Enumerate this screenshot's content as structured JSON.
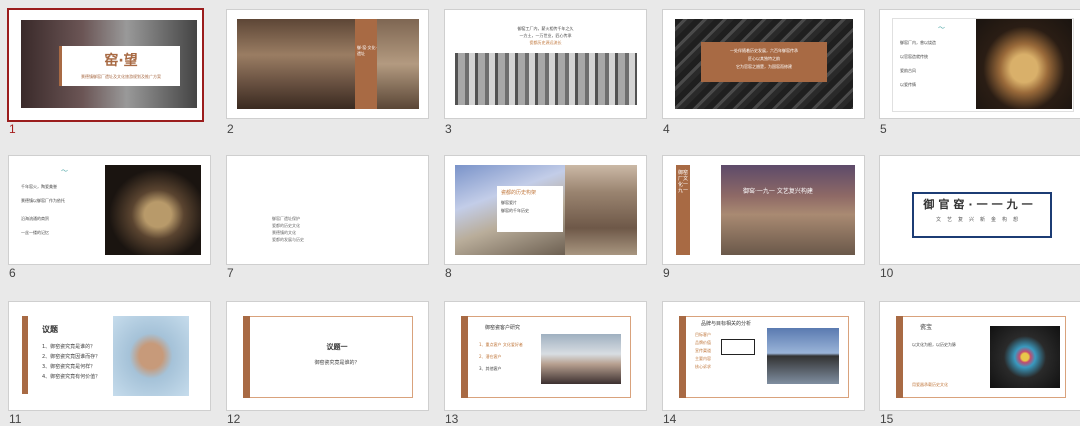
{
  "slides": [
    {
      "n": "1",
      "title": "窑·望",
      "subtitle": "景德镇御窑厂遗址及文化旅游规划及推广方案"
    },
    {
      "n": "2",
      "caption": "御·窑·文化·遗址",
      "sub": "景德镇"
    },
    {
      "n": "3",
      "lines": [
        "御窑工厂内，薪火相传千年之久",
        "一方土，一万世业，匠心传承",
        "瓷都历史源远流长"
      ]
    },
    {
      "n": "4",
      "lines": [
        "一处伴随着历史发展，六百年御窑传承",
        "匠心以其独特之韵",
        "它为官窑之翘楚，为国窑而修建"
      ]
    },
    {
      "n": "5",
      "lines": [
        "御窑厂内，曾以烧造",
        "以官窑造就传统",
        "瓷韵古风",
        "以瓷传情"
      ]
    },
    {
      "n": "6",
      "lines": [
        "千年窑火，陶瓷美誉",
        "景德镇以御窑厂作为依托",
        "沿海流通的商贸",
        "一丝一缕的记忆"
      ]
    },
    {
      "n": "7",
      "lines": [
        "御窑厂遗址保护",
        "瓷都的历史文化",
        "景德镇的文化",
        "瓷都的发展与历史"
      ]
    },
    {
      "n": "8",
      "label": "瓷都的历史构架",
      "lines": [
        "御窑瓷片",
        "御窑的千年历史"
      ]
    },
    {
      "n": "9",
      "title": "御窑·一九一",
      "rest": " 文艺复兴构建",
      "vert": "御窑厂文化一九一"
    },
    {
      "n": "10",
      "title": "御官窑·一一九一",
      "sub": "文艺复兴新金构想"
    },
    {
      "n": "11",
      "title": "议题",
      "items": [
        "1、御窑瓷究竟是谁的？",
        "2、御窑瓷究竟因谁而存？",
        "3、御窑瓷究竟是何样？",
        "4、御窑瓷究竟有何价值？"
      ]
    },
    {
      "n": "12",
      "title": "议题一",
      "sub": "御窑瓷究竟是谁的？"
    },
    {
      "n": "13",
      "title": "御窑瓷客户研究",
      "lines": [
        "1、重点客户 文化爱好者",
        "2、潜在客户",
        "3、其他客户"
      ]
    },
    {
      "n": "14",
      "title": "品牌与目标相关的分析",
      "rows": [
        "目标客户",
        "品牌价值",
        "宣传渠道",
        "主要内容",
        "核心诉求"
      ]
    },
    {
      "n": "15",
      "title": "瓷宝",
      "lines": [
        "以文化为根，以历史为脉",
        "用瓷器承载历史文化"
      ]
    }
  ]
}
